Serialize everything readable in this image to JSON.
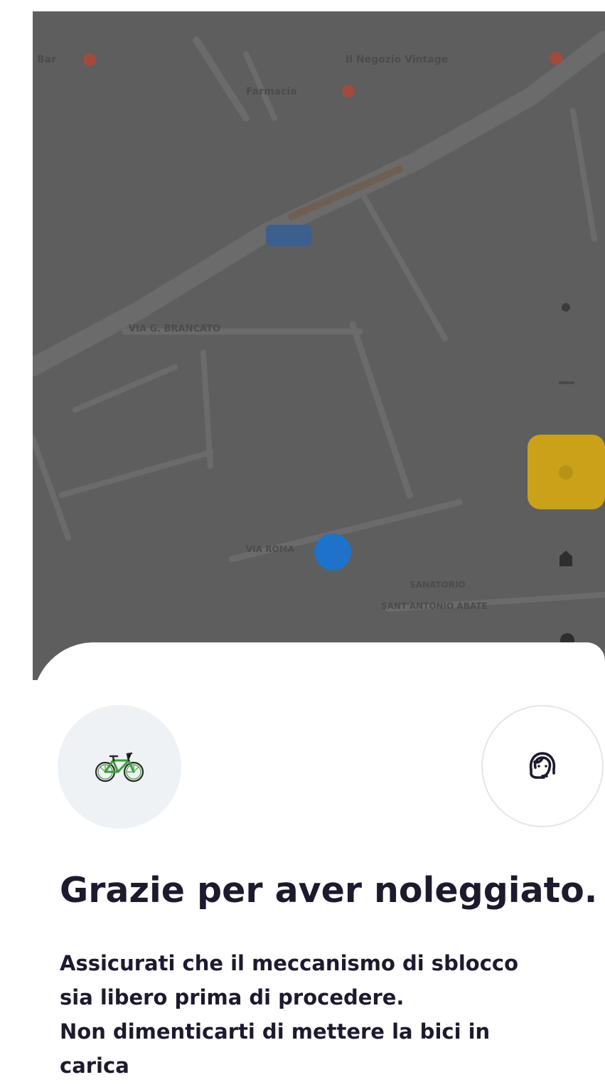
{
  "map": {
    "labels": {
      "top_left": "Bar",
      "top_right": "Il Negozio Vintage",
      "upper_center": "Farmacia",
      "street": "VIA G. BRANCATO",
      "bottom_road": "VIA ROMA",
      "bottom_right_1": "SANATORIO",
      "bottom_right_2": "SANT'ANTONIO ABATE"
    },
    "colors": {
      "overlay": "#5e5e5e",
      "road": "#6a6a6a",
      "poi_pin": "#a34a3e",
      "user_location": "#1f72c9",
      "floating_button": "#c9a219"
    }
  },
  "sheet": {
    "bike_icon": "bicycle-icon",
    "support_icon": "headset-support-icon",
    "title": "Grazie per aver noleggiato.",
    "message_lines": [
      "Assicurati che il meccanismo di sblocco",
      "sia libero prima di procedere.",
      "Non dimenticarti di mettere la bici in",
      "carica"
    ],
    "colors": {
      "text": "#1d1a2e",
      "bike_circle_bg": "#eef2f5",
      "bike_green": "#3f9c3f"
    }
  }
}
